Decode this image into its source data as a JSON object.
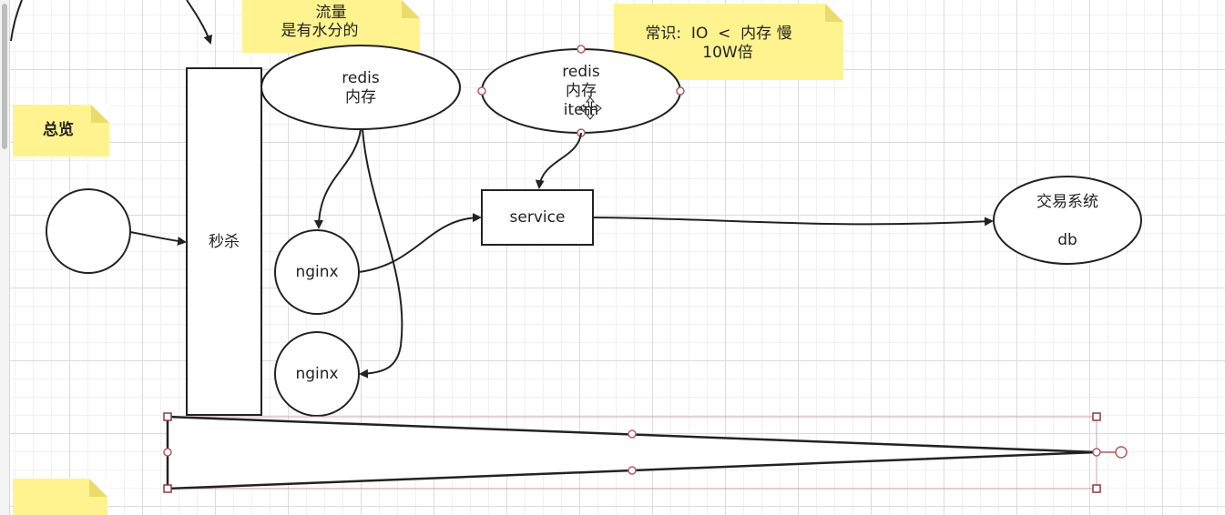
{
  "notes": {
    "traffic_line1": "流量",
    "traffic_line2": "是有水分的",
    "common_line1": "常识:  IO  <  内存 慢",
    "common_line2": "10W倍",
    "overview": "总览"
  },
  "nodes": {
    "seckill": "秒杀",
    "redis_top_line1": "redis",
    "redis_top_line2": "内存",
    "redis_item_line1": "redis",
    "redis_item_line2": "内存",
    "redis_item_line3": "item",
    "nginx1": "nginx",
    "nginx2": "nginx",
    "service": "service",
    "trade_line1": "交易系统",
    "trade_line2": "db"
  },
  "colors": {
    "note_bg": "#fff38f",
    "stroke": "#222222",
    "handle": "#b25b63",
    "grid": "#dcdcdc"
  },
  "icons": {
    "move_cursor": "move-cursor-icon"
  }
}
